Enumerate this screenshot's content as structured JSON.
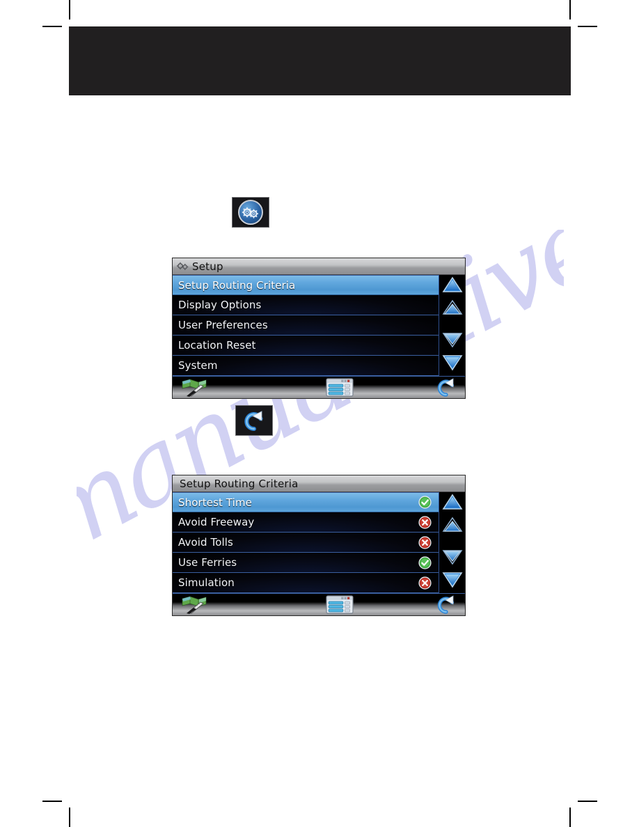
{
  "page": {
    "banner_text": "",
    "watermark_text": "manualshive.com"
  },
  "buttons": {
    "setup_icon_button": {
      "name": "Setup",
      "icon": "gear-icon"
    },
    "return_icon_button": {
      "name": "Return",
      "icon": "return-arrow-icon"
    }
  },
  "setup_screen": {
    "title": "Setup",
    "title_icon": "gear-icon",
    "items": [
      {
        "label": "Setup Routing Criteria",
        "selected": true
      },
      {
        "label": "Display Options",
        "selected": false
      },
      {
        "label": "User Preferences",
        "selected": false
      },
      {
        "label": "Location Reset",
        "selected": false
      },
      {
        "label": "System",
        "selected": false
      }
    ],
    "scroll": {
      "page_up": "page-up-arrow-icon",
      "line_up": "line-up-arrow-icon",
      "line_down": "line-down-arrow-icon",
      "page_down": "page-down-arrow-icon"
    },
    "toolbar": {
      "map": "map-icon",
      "list": "list-window-icon",
      "back": "return-arrow-icon"
    }
  },
  "routing_screen": {
    "title": "Setup Routing Criteria",
    "items": [
      {
        "label": "Shortest Time",
        "status": "on",
        "selected": true
      },
      {
        "label": "Avoid Freeway",
        "status": "off",
        "selected": false
      },
      {
        "label": "Avoid Tolls",
        "status": "off",
        "selected": false
      },
      {
        "label": "Use Ferries",
        "status": "on",
        "selected": false
      },
      {
        "label": "Simulation",
        "status": "off",
        "selected": false
      }
    ],
    "scroll": {
      "page_up": "page-up-arrow-icon",
      "line_up": "line-up-arrow-icon",
      "line_down": "line-down-arrow-icon",
      "page_down": "page-down-arrow-icon"
    },
    "toolbar": {
      "map": "map-icon",
      "list": "list-window-icon",
      "back": "return-arrow-icon"
    }
  },
  "colors": {
    "selected_row": "#5ea5dc",
    "status_on": "#33aa33",
    "status_off": "#c0281e",
    "banner": "#211f20",
    "watermark": "#c9caf2"
  }
}
